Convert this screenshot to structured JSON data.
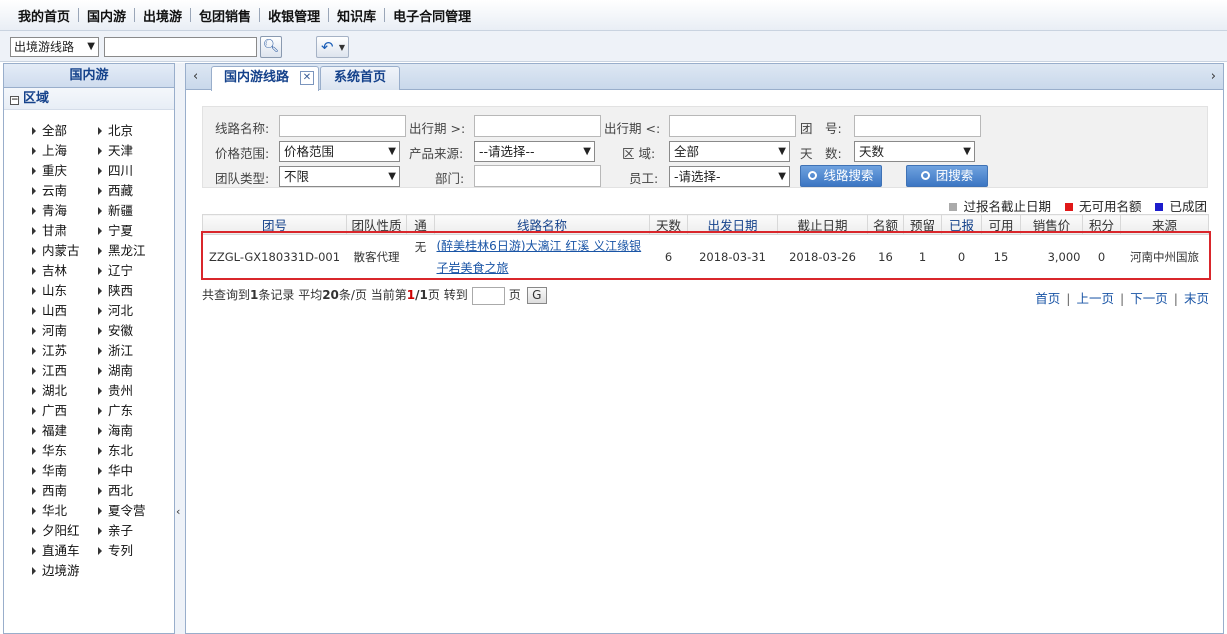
{
  "top_menu": [
    "我的首页",
    "国内游",
    "出境游",
    "包团销售",
    "收银管理",
    "知识库",
    "电子合同管理"
  ],
  "toolbar": {
    "route_type": "出境游线路",
    "search_value": ""
  },
  "sidebar": {
    "title": "国内游",
    "node": "区域",
    "regions": [
      "全部",
      "北京",
      "上海",
      "天津",
      "重庆",
      "四川",
      "云南",
      "西藏",
      "青海",
      "新疆",
      "甘肃",
      "宁夏",
      "内蒙古",
      "黑龙江",
      "吉林",
      "辽宁",
      "山东",
      "陕西",
      "山西",
      "河北",
      "河南",
      "安徽",
      "江苏",
      "浙江",
      "江西",
      "湖南",
      "湖北",
      "贵州",
      "广西",
      "广东",
      "福建",
      "海南",
      "华东",
      "东北",
      "华南",
      "华中",
      "西南",
      "西北",
      "华北",
      "夏令营",
      "夕阳红",
      "亲子",
      "直通车",
      "专列",
      "边境游"
    ]
  },
  "tabs": {
    "active": "国内游线路",
    "inactive": "系统首页"
  },
  "filter": {
    "route_name_label": "线路名称:",
    "depart_after_label": "出行期 >:",
    "depart_before_label": "出行期 <:",
    "group_no_label": "团　号:",
    "price_label": "价格范围:",
    "price_value": "价格范围",
    "source_label": "产品来源:",
    "source_value": "--请选择--",
    "area_label": "区 域:",
    "area_value": "全部",
    "days_label": "天　数:",
    "days_value": "天数",
    "team_type_label": "团队类型:",
    "team_type_value": "不限",
    "dept_label": "部门:",
    "staff_label": "员工:",
    "staff_value": "-请选择-",
    "route_search_btn": "线路搜索",
    "group_search_btn": "团搜索"
  },
  "legend": [
    {
      "label": "过报名截止日期",
      "color": "#aaaaaa"
    },
    {
      "label": "无可用名额",
      "color": "#e01818"
    },
    {
      "label": "已成团",
      "color": "#1d1dcc"
    }
  ],
  "table": {
    "headers": [
      "团号",
      "团队性质",
      "通",
      "线路名称",
      "天数",
      "出发日期",
      "截止日期",
      "名额",
      "预留",
      "已报",
      "可用",
      "销售价",
      "积分",
      "来源"
    ],
    "rows": [
      [
        "ZZGL-GX180331D-001",
        "散客代理",
        "无",
        "(醉美桂林6日游)大漓江 红溪 义江缘银子岩美食之旅",
        "6",
        "2018-03-31",
        "2018-03-26",
        "16",
        "1",
        "0",
        "15",
        "3,000",
        "0",
        "河南中州国旅"
      ]
    ]
  },
  "pager": {
    "t1": "共查询到",
    "total": "1",
    "t2": "条记录 平均",
    "per_page": "20",
    "t3": "条/页 当前第",
    "current": "1",
    "slash": "/",
    "pages": "1",
    "t4": "页 转到",
    "t5": "页",
    "go": "G",
    "first": "首页",
    "prev": "上一页",
    "next": "下一页",
    "last": "末页"
  }
}
